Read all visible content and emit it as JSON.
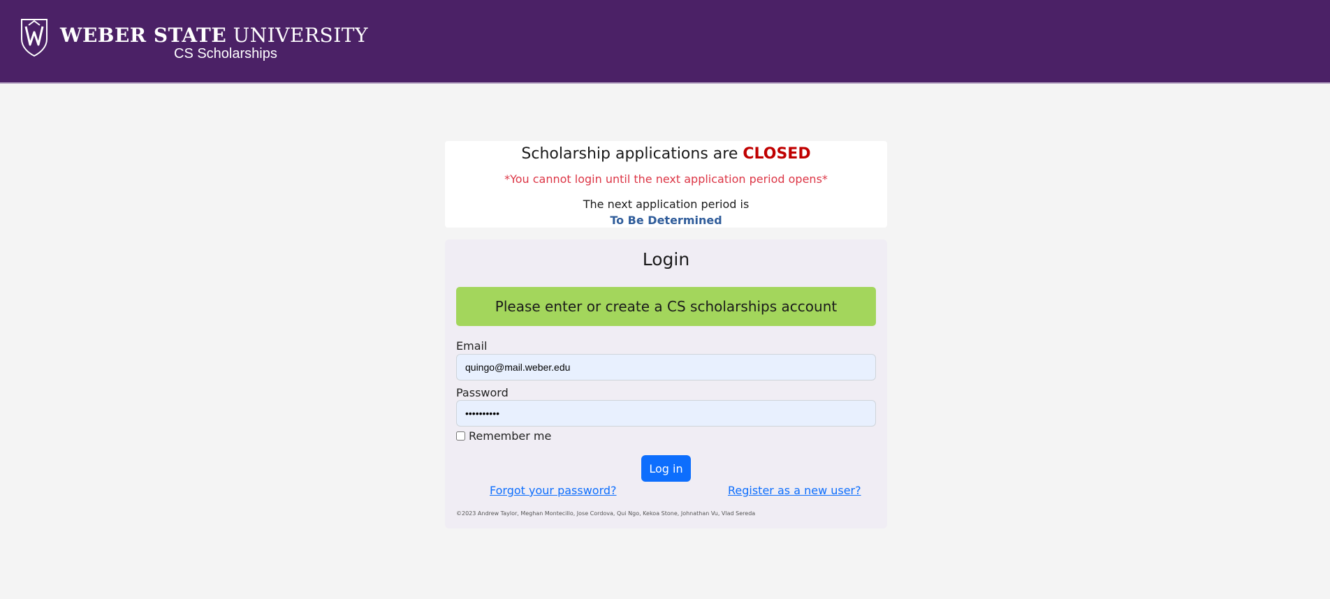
{
  "header": {
    "brand_bold": "WEBER STATE",
    "brand_light": "UNIVERSITY",
    "subtitle": "CS Scholarships",
    "logo_icon": "weber-state-shield-icon"
  },
  "status": {
    "title_prefix": "Scholarship applications are",
    "title_status": "CLOSED",
    "warning": "*You cannot login until the next application period opens*",
    "next_label": "The next application period is",
    "next_value": "To Be Determined"
  },
  "login": {
    "title": "Login",
    "notice": "Please enter or create a CS scholarships account",
    "email_label": "Email",
    "email_value": "quingo@mail.weber.edu",
    "password_label": "Password",
    "password_value": "••••••••••",
    "remember_label": "Remember me",
    "login_button": "Log in",
    "forgot_link": "Forgot your password?",
    "register_link": "Register as a new user?",
    "copyright": "©2023 Andrew Taylor, Meghan Montecillo, Jose Cordova, Qui Ngo, Kekoa Stone, Johnathan Vu, Vlad Sereda"
  },
  "colors": {
    "header_bg": "#4b2166",
    "closed": "#c00000",
    "warning": "#dc3545",
    "notice_bg": "#a3d65c",
    "primary": "#0d6efd"
  }
}
